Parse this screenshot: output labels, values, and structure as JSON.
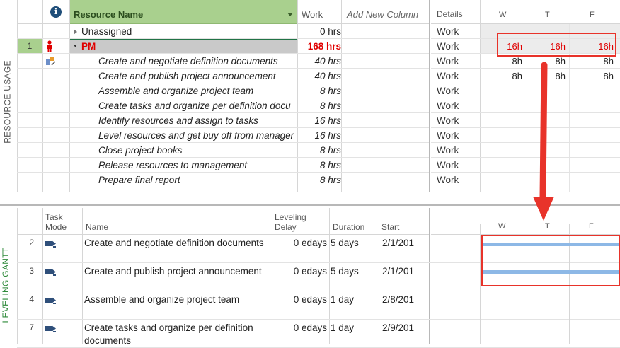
{
  "resource_usage": {
    "side_label": "RESOURCE USAGE",
    "columns": {
      "info": "i",
      "resource_name": "Resource Name",
      "work": "Work",
      "add_new": "Add New Column"
    },
    "rows": [
      {
        "id": "",
        "name": "Unassigned",
        "work": "0 hrs",
        "type": "group"
      },
      {
        "id": "1",
        "name": "PM",
        "work": "168 hrs",
        "type": "resource"
      },
      {
        "id": "",
        "name": "Create and negotiate definition documents",
        "work": "40 hrs",
        "type": "task"
      },
      {
        "id": "",
        "name": "Create and publish project announcement",
        "work": "40 hrs",
        "type": "task"
      },
      {
        "id": "",
        "name": "Assemble and organize project team",
        "work": "8 hrs",
        "type": "task"
      },
      {
        "id": "",
        "name": "Create tasks and organize per definition docu",
        "work": "8 hrs",
        "type": "task"
      },
      {
        "id": "",
        "name": "Identify resources and assign to tasks",
        "work": "16 hrs",
        "type": "task"
      },
      {
        "id": "",
        "name": "Level resources and get buy off from manager",
        "work": "16 hrs",
        "type": "task"
      },
      {
        "id": "",
        "name": "Close project books",
        "work": "8 hrs",
        "type": "task"
      },
      {
        "id": "",
        "name": "Release resources to management",
        "work": "8 hrs",
        "type": "task"
      },
      {
        "id": "",
        "name": "Prepare final report",
        "work": "8 hrs",
        "type": "task"
      }
    ],
    "timescale": {
      "details_header": "Details",
      "days": [
        "W",
        "T",
        "F"
      ],
      "rows": [
        {
          "detail": "Work",
          "values": [
            "",
            "",
            ""
          ]
        },
        {
          "detail": "Work",
          "values": [
            "16h",
            "16h",
            "16h"
          ]
        },
        {
          "detail": "Work",
          "values": [
            "8h",
            "8h",
            "8h"
          ]
        },
        {
          "detail": "Work",
          "values": [
            "8h",
            "8h",
            "8h"
          ]
        },
        {
          "detail": "Work",
          "values": [
            "",
            "",
            ""
          ]
        },
        {
          "detail": "Work",
          "values": [
            "",
            "",
            ""
          ]
        },
        {
          "detail": "Work",
          "values": [
            "",
            "",
            ""
          ]
        },
        {
          "detail": "Work",
          "values": [
            "",
            "",
            ""
          ]
        },
        {
          "detail": "Work",
          "values": [
            "",
            "",
            ""
          ]
        },
        {
          "detail": "Work",
          "values": [
            "",
            "",
            ""
          ]
        },
        {
          "detail": "Work",
          "values": [
            "",
            "",
            ""
          ]
        }
      ]
    }
  },
  "leveling_gantt": {
    "side_label": "LEVELING GANTT",
    "columns": {
      "task_mode_line1": "Task",
      "task_mode_line2": "Mode",
      "name": "Name",
      "delay_line1": "Leveling",
      "delay_line2": "Delay",
      "duration": "Duration",
      "start": "Start"
    },
    "days": [
      "W",
      "T",
      "F"
    ],
    "rows": [
      {
        "id": "2",
        "name": "Create and negotiate definition documents",
        "delay": "0 edays",
        "duration": "5 days",
        "start": "2/1/201"
      },
      {
        "id": "3",
        "name": "Create and publish project announcement",
        "delay": "0 edays",
        "duration": "5 days",
        "start": "2/1/201"
      },
      {
        "id": "4",
        "name": "Assemble and organize project team",
        "delay": "0 edays",
        "duration": "1 day",
        "start": "2/8/201"
      },
      {
        "id": "7",
        "name": "Create tasks and organize per definition documents",
        "delay": "0 edays",
        "duration": "1 day",
        "start": "2/9/201"
      }
    ]
  },
  "colors": {
    "header_green": "#a9d08e",
    "overallocated_red": "#e00000",
    "annotation_red": "#e8332a",
    "gantt_bar": "#8db8e6",
    "side_label_green": "#2e8a3a"
  }
}
